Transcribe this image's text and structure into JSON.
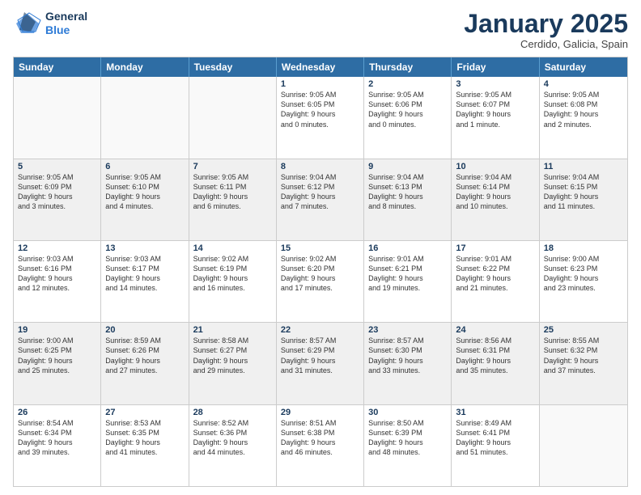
{
  "header": {
    "logo_line1": "General",
    "logo_line2": "Blue",
    "month": "January 2025",
    "location": "Cerdido, Galicia, Spain"
  },
  "weekdays": [
    "Sunday",
    "Monday",
    "Tuesday",
    "Wednesday",
    "Thursday",
    "Friday",
    "Saturday"
  ],
  "rows": [
    [
      {
        "day": "",
        "lines": [],
        "empty": true
      },
      {
        "day": "",
        "lines": [],
        "empty": true
      },
      {
        "day": "",
        "lines": [],
        "empty": true
      },
      {
        "day": "1",
        "lines": [
          "Sunrise: 9:05 AM",
          "Sunset: 6:05 PM",
          "Daylight: 9 hours",
          "and 0 minutes."
        ]
      },
      {
        "day": "2",
        "lines": [
          "Sunrise: 9:05 AM",
          "Sunset: 6:06 PM",
          "Daylight: 9 hours",
          "and 0 minutes."
        ]
      },
      {
        "day": "3",
        "lines": [
          "Sunrise: 9:05 AM",
          "Sunset: 6:07 PM",
          "Daylight: 9 hours",
          "and 1 minute."
        ]
      },
      {
        "day": "4",
        "lines": [
          "Sunrise: 9:05 AM",
          "Sunset: 6:08 PM",
          "Daylight: 9 hours",
          "and 2 minutes."
        ]
      }
    ],
    [
      {
        "day": "5",
        "lines": [
          "Sunrise: 9:05 AM",
          "Sunset: 6:09 PM",
          "Daylight: 9 hours",
          "and 3 minutes."
        ],
        "shaded": true
      },
      {
        "day": "6",
        "lines": [
          "Sunrise: 9:05 AM",
          "Sunset: 6:10 PM",
          "Daylight: 9 hours",
          "and 4 minutes."
        ],
        "shaded": true
      },
      {
        "day": "7",
        "lines": [
          "Sunrise: 9:05 AM",
          "Sunset: 6:11 PM",
          "Daylight: 9 hours",
          "and 6 minutes."
        ],
        "shaded": true
      },
      {
        "day": "8",
        "lines": [
          "Sunrise: 9:04 AM",
          "Sunset: 6:12 PM",
          "Daylight: 9 hours",
          "and 7 minutes."
        ],
        "shaded": true
      },
      {
        "day": "9",
        "lines": [
          "Sunrise: 9:04 AM",
          "Sunset: 6:13 PM",
          "Daylight: 9 hours",
          "and 8 minutes."
        ],
        "shaded": true
      },
      {
        "day": "10",
        "lines": [
          "Sunrise: 9:04 AM",
          "Sunset: 6:14 PM",
          "Daylight: 9 hours",
          "and 10 minutes."
        ],
        "shaded": true
      },
      {
        "day": "11",
        "lines": [
          "Sunrise: 9:04 AM",
          "Sunset: 6:15 PM",
          "Daylight: 9 hours",
          "and 11 minutes."
        ],
        "shaded": true
      }
    ],
    [
      {
        "day": "12",
        "lines": [
          "Sunrise: 9:03 AM",
          "Sunset: 6:16 PM",
          "Daylight: 9 hours",
          "and 12 minutes."
        ]
      },
      {
        "day": "13",
        "lines": [
          "Sunrise: 9:03 AM",
          "Sunset: 6:17 PM",
          "Daylight: 9 hours",
          "and 14 minutes."
        ]
      },
      {
        "day": "14",
        "lines": [
          "Sunrise: 9:02 AM",
          "Sunset: 6:19 PM",
          "Daylight: 9 hours",
          "and 16 minutes."
        ]
      },
      {
        "day": "15",
        "lines": [
          "Sunrise: 9:02 AM",
          "Sunset: 6:20 PM",
          "Daylight: 9 hours",
          "and 17 minutes."
        ]
      },
      {
        "day": "16",
        "lines": [
          "Sunrise: 9:01 AM",
          "Sunset: 6:21 PM",
          "Daylight: 9 hours",
          "and 19 minutes."
        ]
      },
      {
        "day": "17",
        "lines": [
          "Sunrise: 9:01 AM",
          "Sunset: 6:22 PM",
          "Daylight: 9 hours",
          "and 21 minutes."
        ]
      },
      {
        "day": "18",
        "lines": [
          "Sunrise: 9:00 AM",
          "Sunset: 6:23 PM",
          "Daylight: 9 hours",
          "and 23 minutes."
        ]
      }
    ],
    [
      {
        "day": "19",
        "lines": [
          "Sunrise: 9:00 AM",
          "Sunset: 6:25 PM",
          "Daylight: 9 hours",
          "and 25 minutes."
        ],
        "shaded": true
      },
      {
        "day": "20",
        "lines": [
          "Sunrise: 8:59 AM",
          "Sunset: 6:26 PM",
          "Daylight: 9 hours",
          "and 27 minutes."
        ],
        "shaded": true
      },
      {
        "day": "21",
        "lines": [
          "Sunrise: 8:58 AM",
          "Sunset: 6:27 PM",
          "Daylight: 9 hours",
          "and 29 minutes."
        ],
        "shaded": true
      },
      {
        "day": "22",
        "lines": [
          "Sunrise: 8:57 AM",
          "Sunset: 6:29 PM",
          "Daylight: 9 hours",
          "and 31 minutes."
        ],
        "shaded": true
      },
      {
        "day": "23",
        "lines": [
          "Sunrise: 8:57 AM",
          "Sunset: 6:30 PM",
          "Daylight: 9 hours",
          "and 33 minutes."
        ],
        "shaded": true
      },
      {
        "day": "24",
        "lines": [
          "Sunrise: 8:56 AM",
          "Sunset: 6:31 PM",
          "Daylight: 9 hours",
          "and 35 minutes."
        ],
        "shaded": true
      },
      {
        "day": "25",
        "lines": [
          "Sunrise: 8:55 AM",
          "Sunset: 6:32 PM",
          "Daylight: 9 hours",
          "and 37 minutes."
        ],
        "shaded": true
      }
    ],
    [
      {
        "day": "26",
        "lines": [
          "Sunrise: 8:54 AM",
          "Sunset: 6:34 PM",
          "Daylight: 9 hours",
          "and 39 minutes."
        ]
      },
      {
        "day": "27",
        "lines": [
          "Sunrise: 8:53 AM",
          "Sunset: 6:35 PM",
          "Daylight: 9 hours",
          "and 41 minutes."
        ]
      },
      {
        "day": "28",
        "lines": [
          "Sunrise: 8:52 AM",
          "Sunset: 6:36 PM",
          "Daylight: 9 hours",
          "and 44 minutes."
        ]
      },
      {
        "day": "29",
        "lines": [
          "Sunrise: 8:51 AM",
          "Sunset: 6:38 PM",
          "Daylight: 9 hours",
          "and 46 minutes."
        ]
      },
      {
        "day": "30",
        "lines": [
          "Sunrise: 8:50 AM",
          "Sunset: 6:39 PM",
          "Daylight: 9 hours",
          "and 48 minutes."
        ]
      },
      {
        "day": "31",
        "lines": [
          "Sunrise: 8:49 AM",
          "Sunset: 6:41 PM",
          "Daylight: 9 hours",
          "and 51 minutes."
        ]
      },
      {
        "day": "",
        "lines": [],
        "empty": true
      }
    ]
  ]
}
